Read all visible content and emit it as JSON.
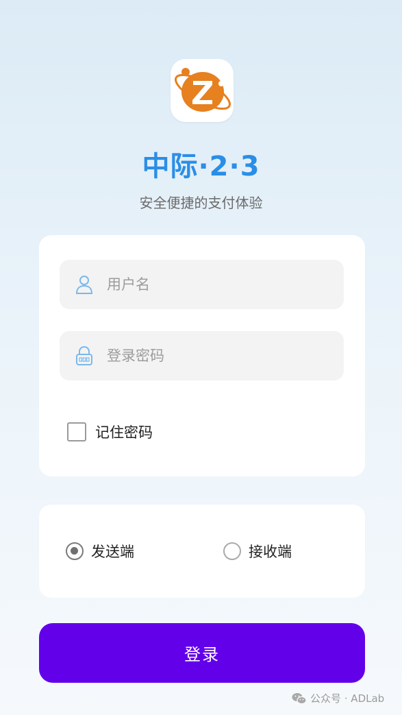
{
  "app": {
    "title": "中际·2·3",
    "subtitle": "安全便捷的支付体验"
  },
  "login_form": {
    "username_placeholder": "用户名",
    "password_placeholder": "登录密码",
    "remember_label": "记住密码",
    "remember_checked": false
  },
  "role": {
    "options": [
      {
        "label": "发送端",
        "selected": true
      },
      {
        "label": "接收端",
        "selected": false
      }
    ]
  },
  "login_button": "登录",
  "watermark": "公众号 · ADLab",
  "colors": {
    "brand": "#2a8ee6",
    "primary_button": "#6200ea",
    "logo_orange": "#e67e22"
  }
}
